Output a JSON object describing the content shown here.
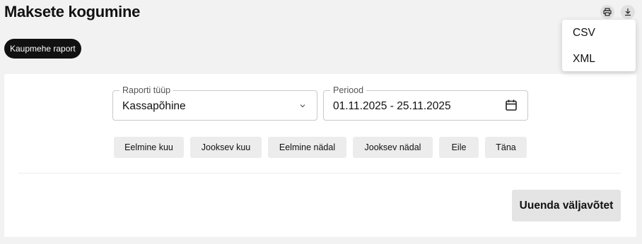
{
  "header": {
    "title": "Maksete kogumine",
    "print_icon": "print-icon",
    "download_icon": "download-icon"
  },
  "report_chip": {
    "label": "Kaupmehe raport"
  },
  "form": {
    "report_type": {
      "label": "Raporti tüüp",
      "value": "Kassapõhine",
      "icon": "chevron-down-icon"
    },
    "period": {
      "label": "Periood",
      "value": "01.11.2025 - 25.11.2025",
      "icon": "calendar-icon"
    }
  },
  "quick_ranges": [
    "Eelmine kuu",
    "Jooksev kuu",
    "Eelmine nädal",
    "Jooksev nädal",
    "Eile",
    "Täna"
  ],
  "refresh_button": {
    "label": "Uuenda väljavõtet"
  },
  "download_menu": {
    "items": [
      "CSV",
      "XML"
    ]
  },
  "colors": {
    "background": "#f2f2f2",
    "card": "#ffffff",
    "chip": "#111111",
    "button": "#e4e4e4"
  }
}
